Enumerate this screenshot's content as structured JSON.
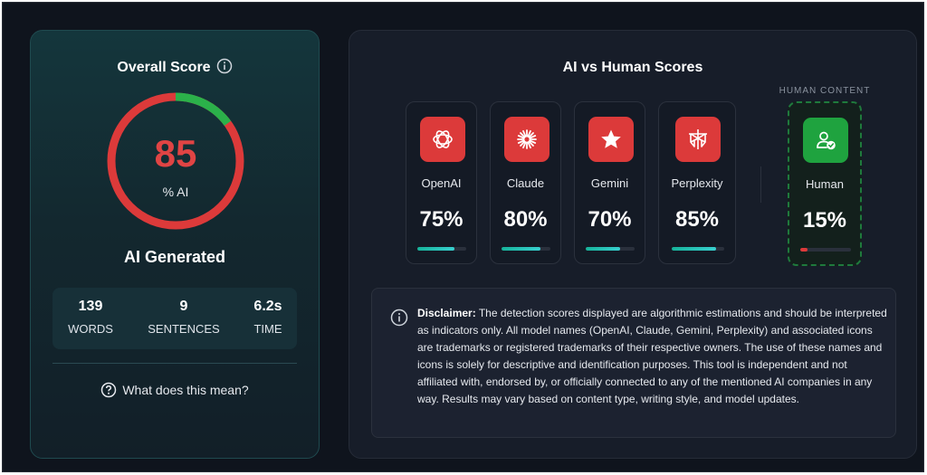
{
  "overall": {
    "title": "Overall Score",
    "score": "85",
    "unit": "% AI",
    "ai_fraction": 0.85,
    "verdict": "AI Generated",
    "colors": {
      "ai": "#dc3a3a",
      "human": "#2bb14a"
    }
  },
  "stats": [
    {
      "value": "139",
      "label": "WORDS"
    },
    {
      "value": "9",
      "label": "SENTENCES"
    },
    {
      "value": "6.2s",
      "label": "TIME"
    }
  ],
  "help_label": "What does this mean?",
  "compare": {
    "title": "AI vs Human Scores",
    "models": [
      {
        "name": "OpenAI",
        "percent": "75%",
        "fill": 0.75,
        "icon": "openai-icon"
      },
      {
        "name": "Claude",
        "percent": "80%",
        "fill": 0.8,
        "icon": "claude-icon"
      },
      {
        "name": "Gemini",
        "percent": "70%",
        "fill": 0.7,
        "icon": "gemini-star-icon"
      },
      {
        "name": "Perplexity",
        "percent": "85%",
        "fill": 0.85,
        "icon": "perplexity-icon"
      }
    ],
    "human": {
      "section_label": "HUMAN CONTENT",
      "name": "Human",
      "percent": "15%",
      "fill": 0.15,
      "icon": "human-check-icon"
    }
  },
  "disclaimer": {
    "label": "Disclaimer:",
    "text": "The detection scores displayed are algorithmic estimations and should be interpreted as indicators only. All model names (OpenAI, Claude, Gemini, Perplexity) and associated icons are trademarks or registered trademarks of their respective owners. The use of these names and icons is solely for descriptive and identification purposes. This tool is independent and not affiliated with, endorsed by, or officially connected to any of the mentioned AI companies in any way. Results may vary based on content type, writing style, and model updates."
  }
}
